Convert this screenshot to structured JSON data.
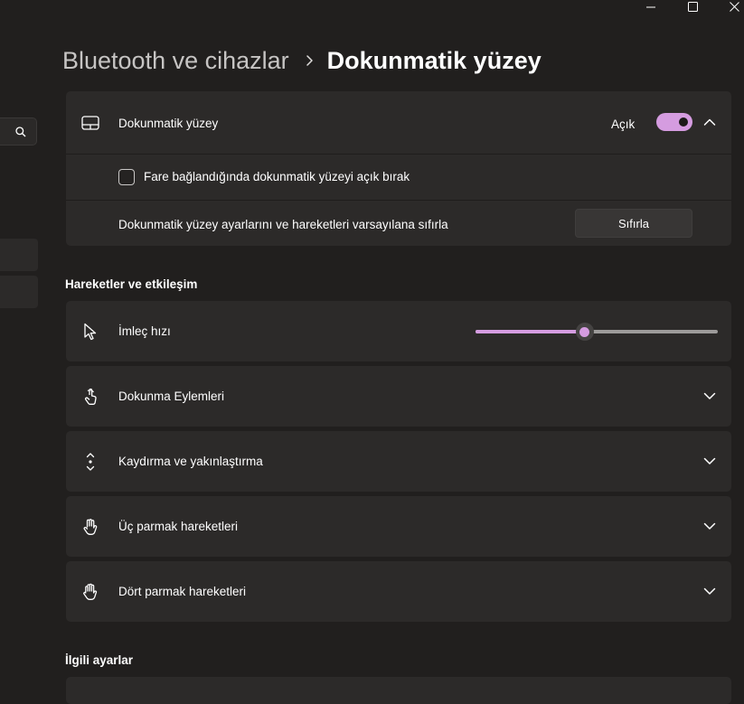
{
  "breadcrumb": {
    "parent": "Bluetooth ve cihazlar",
    "current": "Dokunmatik yüzey"
  },
  "touchpad_card": {
    "title": "Dokunmatik yüzey",
    "toggle_label": "Açık",
    "toggle_on": true,
    "checkbox_label": "Fare bağlandığında dokunmatik yüzeyi açık bırak",
    "checkbox_checked": false,
    "reset_label": "Dokunmatik yüzey ayarlarını ve hareketleri varsayılana sıfırla",
    "reset_button": "Sıfırla"
  },
  "gestures_section": {
    "title": "Hareketler ve etkileşim",
    "cursor_speed": {
      "label": "İmleç hızı",
      "value_fraction": 0.45
    },
    "items": [
      {
        "label": "Dokunma Eylemleri",
        "icon": "tap-icon"
      },
      {
        "label": "Kaydırma ve yakınlaştırma",
        "icon": "scroll-zoom-icon"
      },
      {
        "label": "Üç parmak hareketleri",
        "icon": "three-finger-icon"
      },
      {
        "label": "Dört parmak hareketleri",
        "icon": "four-finger-icon"
      }
    ]
  },
  "related_section": {
    "title": "İlgili ayarlar"
  },
  "colors": {
    "accent": "#d59ce0",
    "background": "#211f1e",
    "card": "#2c2a29"
  }
}
